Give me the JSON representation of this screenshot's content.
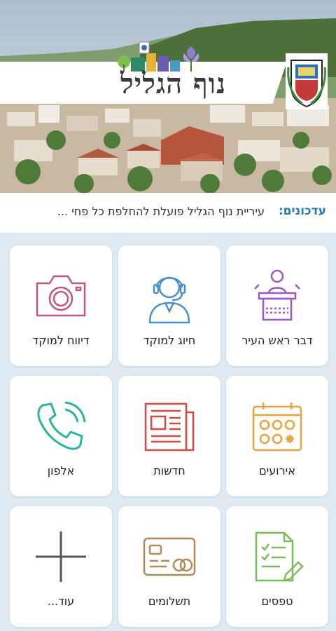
{
  "header": {
    "city_logo_text": "נוף הגליל"
  },
  "ticker": {
    "label": "עדכונים:",
    "text": "עיריית נוף הגליל פועלת להחלפת כל פחי ..."
  },
  "tiles": [
    {
      "label": "דבר ראש העיר",
      "icon": "podium-speaker-icon",
      "color": "#9b59c4"
    },
    {
      "label": "חיוג למוקד",
      "icon": "headset-agent-icon",
      "color": "#4a8fc7"
    },
    {
      "label": "דיווח למוקד",
      "icon": "camera-icon",
      "color": "#c3577a"
    },
    {
      "label": "אירועים",
      "icon": "calendar-icon",
      "color": "#e8a33a"
    },
    {
      "label": "חדשות",
      "icon": "newspaper-icon",
      "color": "#d94848"
    },
    {
      "label": "אלפון",
      "icon": "phone-icon",
      "color": "#2bb3a0"
    },
    {
      "label": "טפסים",
      "icon": "form-document-icon",
      "color": "#7dbb5a"
    },
    {
      "label": "תשלומים",
      "icon": "credit-card-icon",
      "color": "#b08a5a"
    },
    {
      "label": "עוד...",
      "icon": "plus-icon",
      "color": "#555555"
    }
  ]
}
